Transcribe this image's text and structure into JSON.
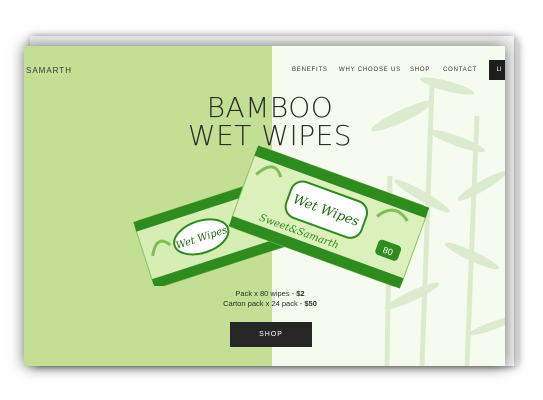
{
  "brand": "SAMARTH",
  "nav": {
    "items": [
      "BENEFITS",
      "WHY CHOOSE US",
      "SHOP",
      "CONTACT"
    ],
    "cta_label": "LI"
  },
  "hero": {
    "title_line1": "BAMBOO",
    "title_line2": "WET WIPES"
  },
  "product": {
    "brand_label": "Wet Wipes",
    "script_label": "Sweet&Samarth",
    "count_badge": "80"
  },
  "pricing": {
    "line1_text": "Pack x 80 wipes  - ",
    "line1_price": "$2",
    "line2_text": "Carton pack x 24 pack - ",
    "line2_price": "$50"
  },
  "cta": {
    "shop_label": "SHOP"
  },
  "colors": {
    "left_panel": "#c2df93",
    "right_panel": "#f6fbef",
    "dark": "#262626",
    "pack_green": "#2e8b1e"
  }
}
